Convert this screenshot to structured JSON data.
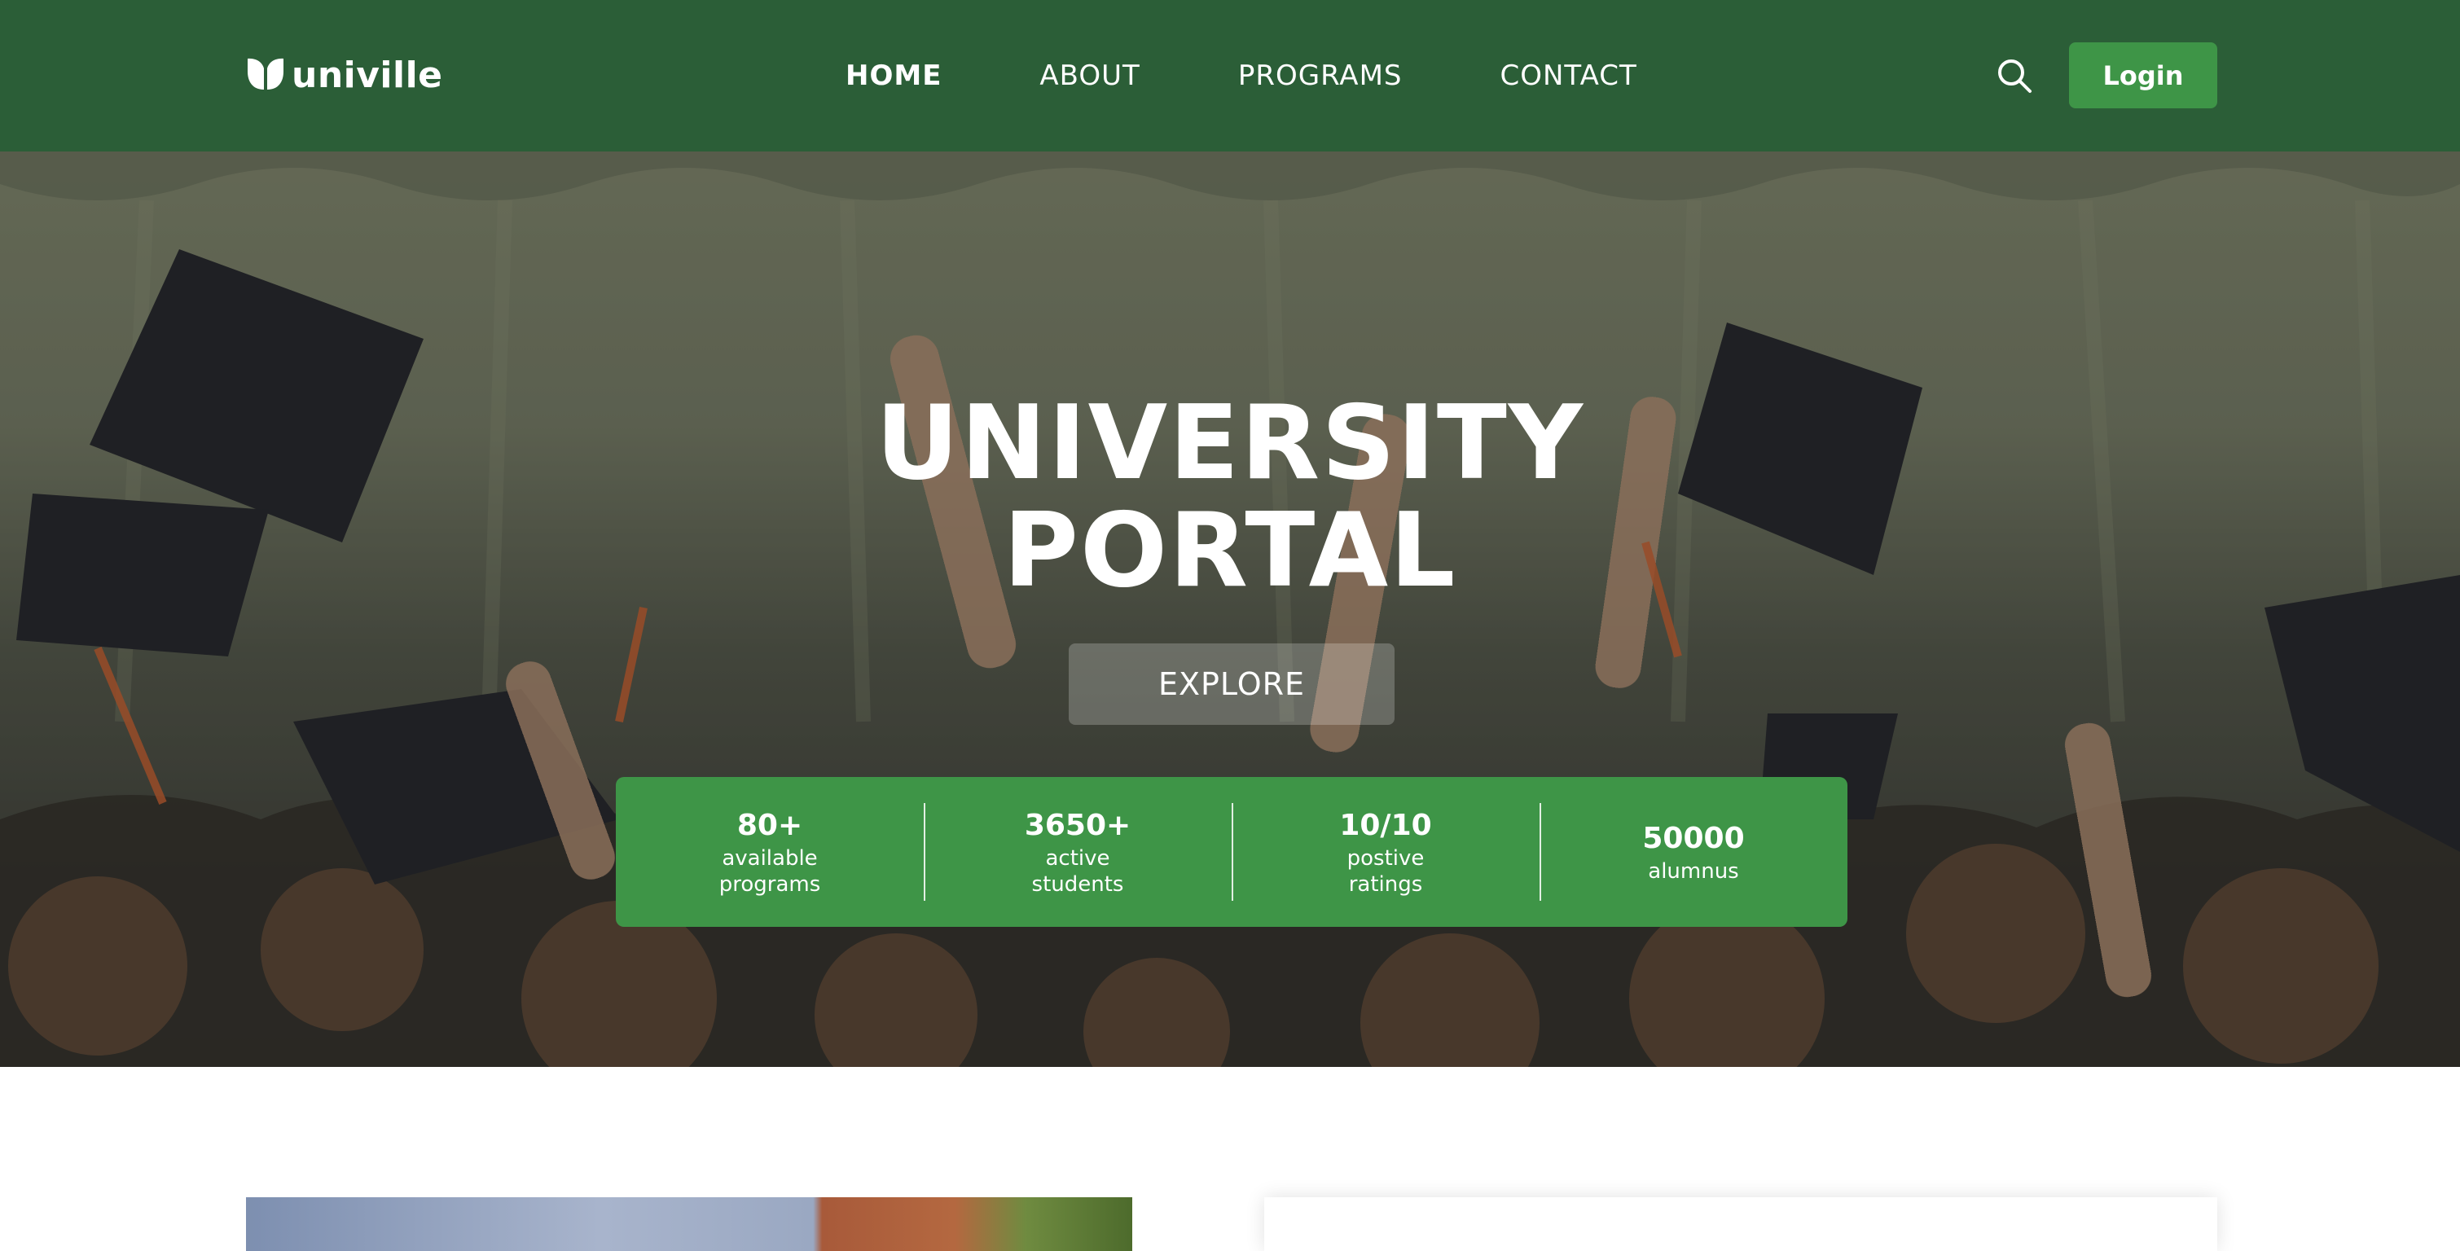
{
  "brand": {
    "name": "univille",
    "logo_icon": "leaf-logo-icon"
  },
  "nav": {
    "links": [
      "HOME",
      "ABOUT",
      "PROGRAMS",
      "CONTACT"
    ],
    "active": "HOME",
    "search_icon": "search-icon",
    "login_label": "Login"
  },
  "hero": {
    "title_line1": "UNIVERSITY",
    "title_line2": "PORTAL",
    "explore_label": "EXPLORE",
    "background": "graduates-throwing-caps-photo"
  },
  "stats": [
    {
      "value": "80+",
      "label": "available programs"
    },
    {
      "value": "3650+",
      "label": "active students"
    },
    {
      "value": "10/10",
      "label": "postive ratings"
    },
    {
      "value": "50000",
      "label": "alumnus"
    }
  ],
  "colors": {
    "nav_bg": "#2b5e37",
    "accent": "#3e9547",
    "text_light": "#ffffff"
  }
}
